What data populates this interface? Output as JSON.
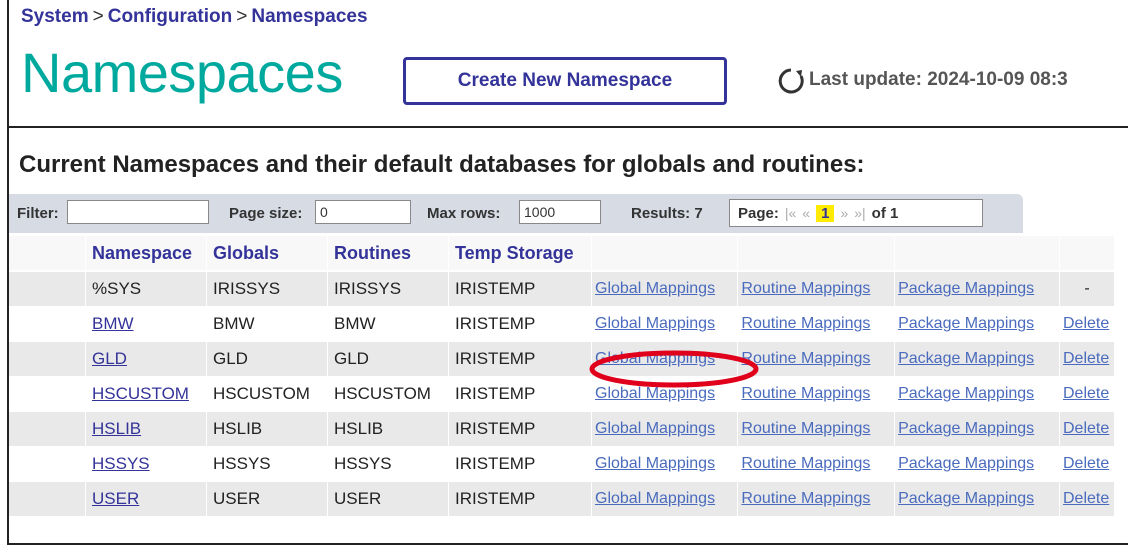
{
  "breadcrumb": {
    "items": [
      "System",
      "Configuration",
      "Namespaces"
    ],
    "separator": ">"
  },
  "header": {
    "title": "Namespaces",
    "create_button": "Create New Namespace",
    "last_update": "Last update: 2024-10-09 08:3",
    "refresh_icon": "refresh-icon"
  },
  "section_title": "Current Namespaces and their default databases for globals and routines:",
  "filterbar": {
    "filter_label": "Filter:",
    "filter_value": "",
    "page_size_label": "Page size:",
    "page_size_value": "0",
    "max_rows_label": "Max rows:",
    "max_rows_value": "1000",
    "results": "Results: 7",
    "page_label": "Page:",
    "first": "|«",
    "prev": "«",
    "current_page": "1",
    "next": "»",
    "last": "»|",
    "of_pages": "of 1"
  },
  "table": {
    "headers": [
      "Namespace",
      "Globals",
      "Routines",
      "Temp Storage"
    ],
    "link_labels": {
      "global": "Global Mappings",
      "routine": "Routine Mappings",
      "package": "Package Mappings",
      "delete": "Delete"
    },
    "rows": [
      {
        "namespace": "%SYS",
        "globals": "IRISSYS",
        "routines": "IRISSYS",
        "temp": "IRISTEMP",
        "delete": "-"
      },
      {
        "namespace": "BMW",
        "globals": "BMW",
        "routines": "BMW",
        "temp": "IRISTEMP",
        "delete": "Delete"
      },
      {
        "namespace": "GLD",
        "globals": "GLD",
        "routines": "GLD",
        "temp": "IRISTEMP",
        "delete": "Delete"
      },
      {
        "namespace": "HSCUSTOM",
        "globals": "HSCUSTOM",
        "routines": "HSCUSTOM",
        "temp": "IRISTEMP",
        "delete": "Delete"
      },
      {
        "namespace": "HSLIB",
        "globals": "HSLIB",
        "routines": "HSLIB",
        "temp": "IRISTEMP",
        "delete": "Delete"
      },
      {
        "namespace": "HSSYS",
        "globals": "HSSYS",
        "routines": "HSSYS",
        "temp": "IRISTEMP",
        "delete": "Delete"
      },
      {
        "namespace": "USER",
        "globals": "USER",
        "routines": "USER",
        "temp": "IRISTEMP",
        "delete": "Delete"
      }
    ]
  },
  "colors": {
    "title": "#00a99d",
    "link": "#333399",
    "annotation": "#e0001b",
    "highlight": "#ffeb00"
  }
}
